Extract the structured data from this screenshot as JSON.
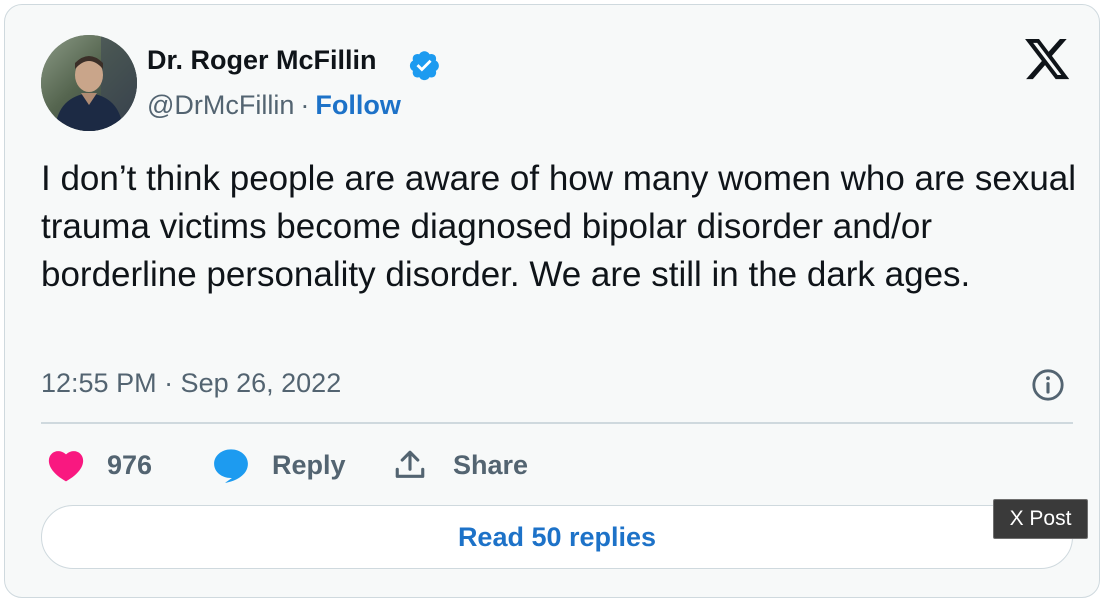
{
  "author": {
    "name": "Dr. Roger McFillin",
    "handle": "@DrMcFillin",
    "separator": "·",
    "follow_label": "Follow"
  },
  "tweet": {
    "text": "I don’t think people are aware of how many women who are sexual trauma victims become diagnosed bipolar disorder and/or borderline personality disorder. We are still in the dark ages.",
    "timestamp": "12:55 PM · Sep 26, 2022"
  },
  "actions": {
    "like_count": "976",
    "reply_label": "Reply",
    "share_label": "Share"
  },
  "read_replies_label": "Read 50 replies",
  "badge_label": "X Post",
  "icons": {
    "verified": "verified-badge-icon",
    "logo": "x-logo-icon",
    "info": "info-icon",
    "like": "heart-icon",
    "reply": "speech-bubble-icon",
    "share": "share-upload-icon"
  },
  "colors": {
    "link": "#1d72c8",
    "like": "#f91880",
    "reply": "#1d9bf0",
    "verified": "#1d9bf0",
    "muted": "#536471"
  }
}
